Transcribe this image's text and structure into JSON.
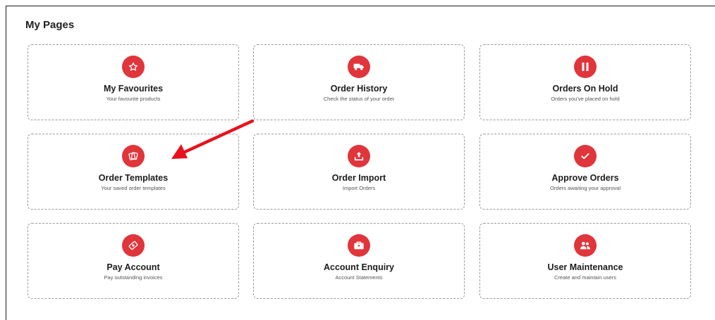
{
  "page": {
    "title": "My Pages"
  },
  "cards": [
    {
      "title": "My Favourites",
      "subtitle": "Your favourite products",
      "icon": "star-icon"
    },
    {
      "title": "Order History",
      "subtitle": "Check the status of your order",
      "icon": "truck-icon"
    },
    {
      "title": "Orders On Hold",
      "subtitle": "Orders you've placed on hold",
      "icon": "pause-icon"
    },
    {
      "title": "Order Templates",
      "subtitle": "Your saved order templates",
      "icon": "templates-icon"
    },
    {
      "title": "Order Import",
      "subtitle": "Import Orders",
      "icon": "upload-icon"
    },
    {
      "title": "Approve Orders",
      "subtitle": "Orders awaiting your approval",
      "icon": "checkmark-icon"
    },
    {
      "title": "Pay Account",
      "subtitle": "Pay outstanding invoices",
      "icon": "payment-icon"
    },
    {
      "title": "Account Enquiry",
      "subtitle": "Account Statements",
      "icon": "briefcase-icon"
    },
    {
      "title": "User Maintenance",
      "subtitle": "Create and maintain users",
      "icon": "users-icon"
    }
  ],
  "colors": {
    "accent": "#e0353b",
    "annotation_arrow": "#e8111c"
  }
}
